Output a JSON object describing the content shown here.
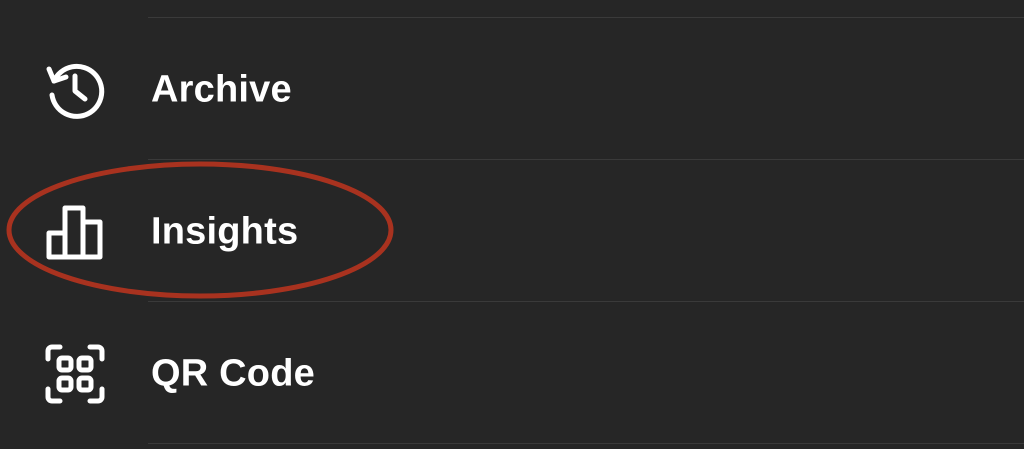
{
  "menu": {
    "items": [
      {
        "label": "Archive",
        "icon": "archive-history-icon"
      },
      {
        "label": "Insights",
        "icon": "insights-bar-chart-icon"
      },
      {
        "label": "QR Code",
        "icon": "qr-code-scan-icon"
      }
    ]
  },
  "annotation": {
    "type": "ellipse",
    "target": "Insights",
    "color": "#a8321f"
  },
  "colors": {
    "background": "#262626",
    "divider": "#3a3a3a",
    "text": "#ffffff",
    "icon": "#ffffff"
  }
}
